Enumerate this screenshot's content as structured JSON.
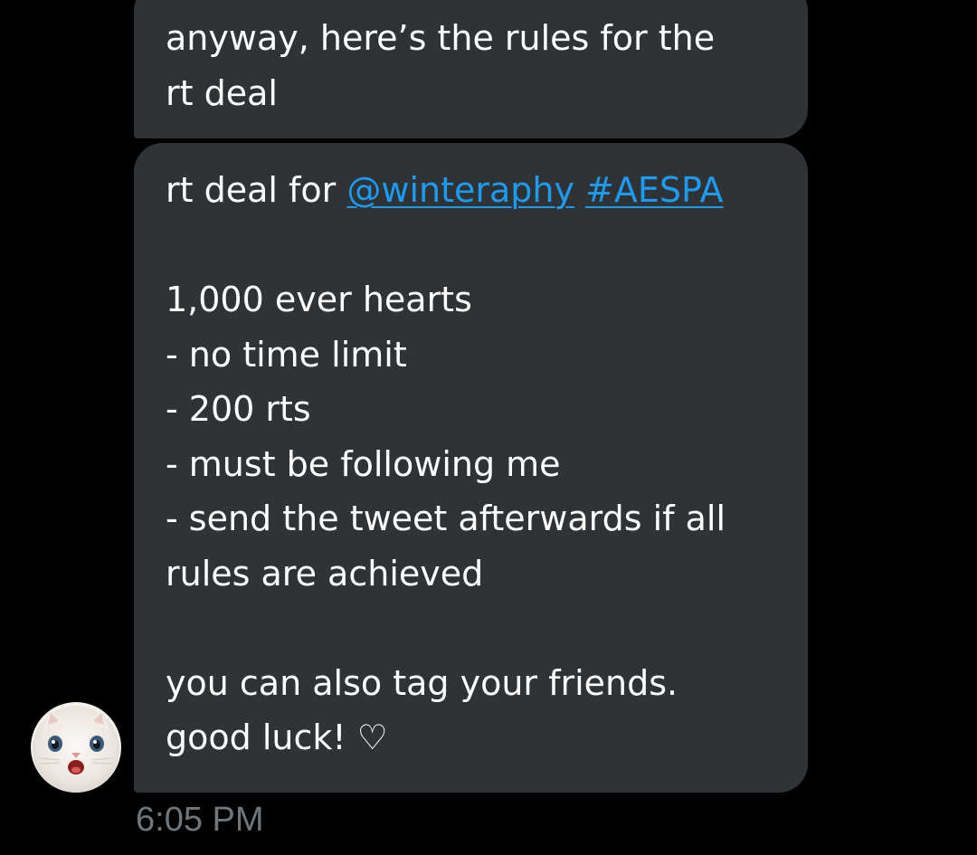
{
  "messages": [
    {
      "lines": [
        "anyway, here’s the rules for the",
        "rt deal"
      ]
    },
    {
      "intro_text": "rt deal for ",
      "mention": "@winteraphy",
      "hashtag": "#AESPA",
      "lines": [
        "1,000 ever hearts",
        "- no time limit",
        "- 200 rts",
        "- must be following me",
        "- send the tweet afterwards if all",
        "rules are achieved"
      ],
      "closing": [
        "you can also tag your friends.",
        "good luck! ♡"
      ]
    }
  ],
  "timestamp": "6:05 PM",
  "colors": {
    "background": "#000000",
    "bubble": "#2f3336",
    "text": "#ffffff",
    "link": "#1d9bf0",
    "timestamp": "#71767b"
  },
  "avatar": {
    "icon": "white-cat-avatar-icon"
  }
}
